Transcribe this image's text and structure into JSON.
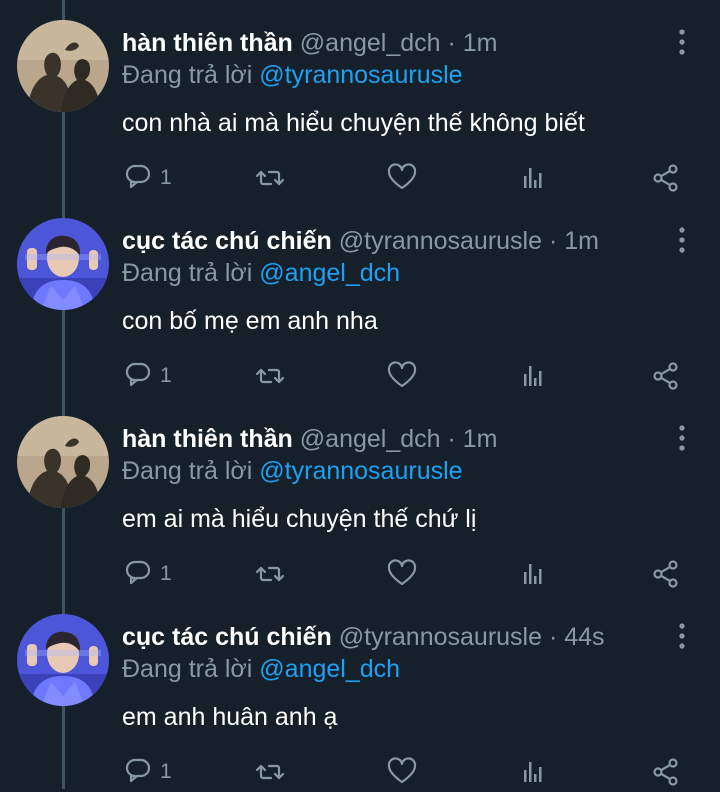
{
  "tweets": [
    {
      "display_name": "hàn thiên thần",
      "handle": "@angel_dch",
      "time": "1m",
      "reply_label": "Đang trả lời",
      "reply_to": "@tyrannosaurusle",
      "text": "con nhà ai mà hiểu chuyện thế không biết",
      "reply_count": "1",
      "avatar": "shadow-photo"
    },
    {
      "display_name": "cục tác chú chiến",
      "handle": "@tyrannosaurusle",
      "time": "1m",
      "reply_label": "Đang trả lời",
      "reply_to": "@angel_dch",
      "text": "con bố mẹ em anh nha",
      "reply_count": "1",
      "avatar": "person-photo"
    },
    {
      "display_name": "hàn thiên thần",
      "handle": "@angel_dch",
      "time": "1m",
      "reply_label": "Đang trả lời",
      "reply_to": "@tyrannosaurusle",
      "text": "em ai mà hiểu chuyện thế chứ lị",
      "reply_count": "1",
      "avatar": "shadow-photo"
    },
    {
      "display_name": "cục tác chú chiến",
      "handle": "@tyrannosaurusle",
      "time": "44s",
      "reply_label": "Đang trả lời",
      "reply_to": "@angel_dch",
      "text": "em anh huân anh ạ",
      "reply_count": "1",
      "avatar": "person-photo"
    }
  ],
  "separator": "·",
  "colors": {
    "background": "#15202b",
    "secondary_text": "#8899a6",
    "link": "#1da1f2",
    "thread_line": "#3d5466"
  },
  "icons": [
    "reply-icon",
    "retweet-icon",
    "like-icon",
    "stats-icon",
    "share-icon",
    "more-icon"
  ]
}
